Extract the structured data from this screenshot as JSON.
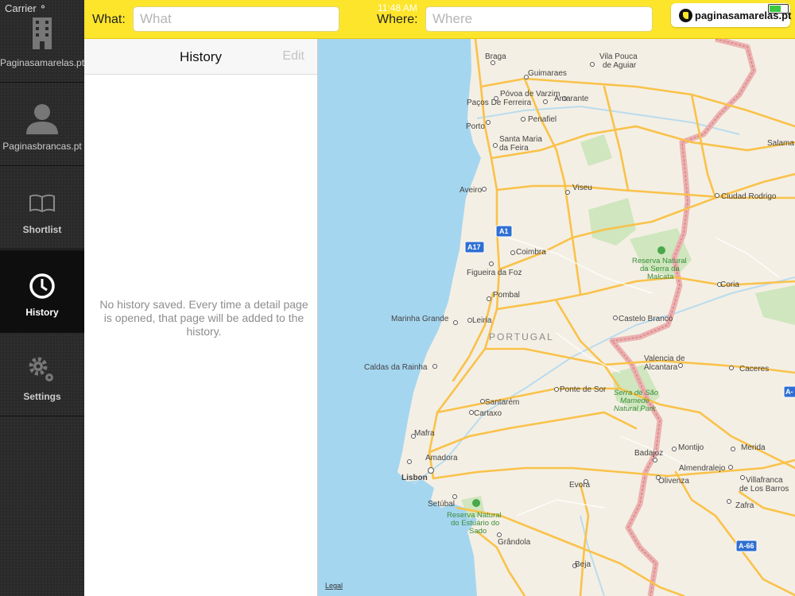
{
  "status_bar": {
    "carrier": "Carrier",
    "time": "11:48 AM"
  },
  "sidebar": {
    "items": [
      {
        "label": "Paginasamarelas.pt",
        "icon": "building-icon"
      },
      {
        "label": "Paginasbrancas.pt",
        "icon": "person-icon"
      },
      {
        "label": "Shortlist",
        "icon": "book-icon"
      },
      {
        "label": "History",
        "icon": "clock-icon",
        "active": true
      },
      {
        "label": "Settings",
        "icon": "gears-icon"
      }
    ]
  },
  "topbar": {
    "what_label": "What:",
    "what_placeholder": "What",
    "where_label": "Where:",
    "where_placeholder": "Where",
    "logo_text": "paginasamarelas.pt"
  },
  "history": {
    "title": "History",
    "edit_label": "Edit",
    "empty_message": "No history saved. Every time a detail page is opened, that page will be added to the history."
  },
  "map": {
    "legal_label": "Legal",
    "country_label": "PORTUGAL",
    "cities": {
      "braga": "Braga",
      "vila_pouca": "Vila Pouca",
      "de_aguiar": "de Aguiar",
      "guimaraes": "Guimaraes",
      "povoa": "Póvoa de Varzim",
      "pacos": "Paços De Ferreira",
      "amarante": "Amarante",
      "penafiel": "Penafiel",
      "porto": "Porto",
      "santa_maria": "Santa Maria",
      "da_feira": "da Feira",
      "salamanca": "Salama",
      "aveiro": "Aveiro",
      "viseu": "Viseu",
      "ciudad_rodrigo": "Ciudad Rodrigo",
      "coimbra": "Coimbra",
      "figueira": "Figueira da Foz",
      "coria": "Coria",
      "pombal": "Pombal",
      "marinha": "Marinha Grande",
      "leiria": "Leiria",
      "castelo": "Castelo Branco",
      "valencia1": "Valencia de",
      "valencia2": "Alcantara",
      "caldas": "Caldas da Rainha",
      "caceres": "Caceres",
      "ponte": "Ponte de Sor",
      "santarem": "Santarém",
      "cartaxo": "Cartaxo",
      "mafra": "Mafra",
      "amadora": "Amadora",
      "lisbon": "Lisbon",
      "badajoz": "Badajoz",
      "montijo": "Montijo",
      "merida": "Merida",
      "almendralejo": "Almendralejo",
      "evora": "Evora",
      "olivenza": "Olivenza",
      "villafranca1": "Villafranca",
      "villafranca2": "de Los Barros",
      "setubal": "Setúbal",
      "zafra": "Zafra",
      "grandola": "Grândola",
      "beja": "Beja"
    },
    "parks": {
      "malcata": [
        "Reserva Natural",
        "da Serra da",
        "Malcata"
      ],
      "mamede": [
        "Serra de São",
        "Mamede",
        "Natural Park"
      ],
      "sado": [
        "Reserva Natural",
        "do Estuário do",
        "Sado"
      ]
    },
    "shields": {
      "a1": "A1",
      "a17": "A17",
      "a66": "A-66",
      "a_edge": "A-"
    }
  },
  "colors": {
    "brand_yellow": "#fde52c",
    "sea": "#a5d6f0",
    "land": "#f4efe4",
    "road": "#f9be3c",
    "border": "#e9a0a0",
    "park": "#bfddb0"
  }
}
